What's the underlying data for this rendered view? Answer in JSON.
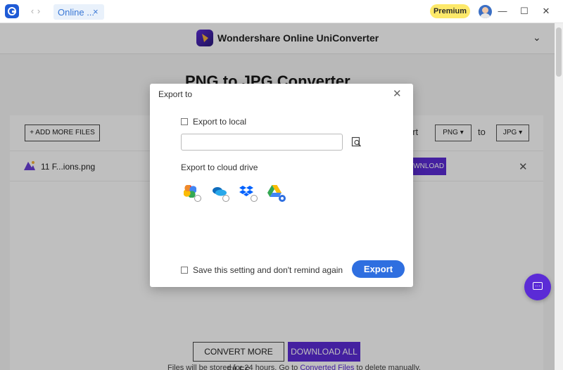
{
  "window": {
    "tab_label": "Online ...",
    "tab_close": "×",
    "premium_label": "Premium",
    "nav_back": "‹",
    "nav_forward": "›",
    "minimize": "—",
    "maximize": "☐",
    "close": "✕"
  },
  "site": {
    "brand_name": "Wondershare Online UniConverter",
    "page_title": "PNG to JPG Converter",
    "add_more_files": "+ ADD MORE FILES",
    "convert_label": "ert",
    "source_format": "PNG",
    "to_label": "to",
    "target_format": "JPG",
    "file_name": "11 F...ions.png",
    "row_download": "DWNLOAD",
    "convert_more_files": "CONVERT MORE FILES",
    "download_all": "DOWNLOAD ALL",
    "footer_prefix": "Files will be stored for 24 hours. Go to ",
    "footer_link": "Converted Files",
    "footer_suffix": " to delete manually."
  },
  "dialog": {
    "title": "Export to",
    "close": "✕",
    "export_local_label": "Export to local",
    "export_local_checked": false,
    "path_value": "",
    "cloud_label": "Export to cloud drive",
    "cloud_drives": [
      {
        "name": "google-photos",
        "selected": false
      },
      {
        "name": "onedrive",
        "selected": false
      },
      {
        "name": "dropbox",
        "selected": false
      },
      {
        "name": "google-drive",
        "selected": true
      }
    ],
    "remember_label": "Save this setting and don't remind again",
    "remember_checked": false,
    "export_button": "Export"
  },
  "colors": {
    "brand_purple": "#5b2bd6",
    "export_blue": "#2f6fe0",
    "premium_yellow": "#fde96a"
  }
}
